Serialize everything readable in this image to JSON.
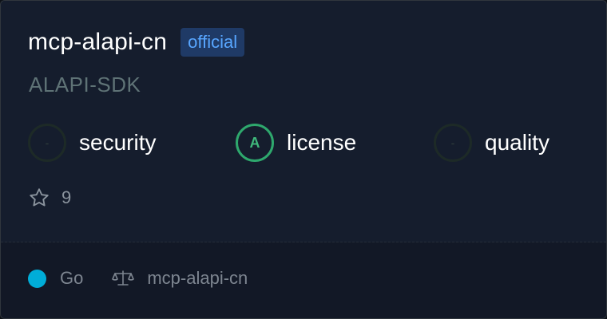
{
  "repo": {
    "name": "mcp-alapi-cn",
    "badge": "official",
    "owner": "ALAPI-SDK"
  },
  "metrics": [
    {
      "label": "security",
      "grade": "-"
    },
    {
      "label": "license",
      "grade": "A"
    },
    {
      "label": "quality",
      "grade": "-"
    }
  ],
  "stars": {
    "count": "9",
    "icon": "star-icon"
  },
  "footer": {
    "language": "Go",
    "language_color": "#00add8",
    "license": "mcp-alapi-cn",
    "license_icon": "scale-icon"
  },
  "colors": {
    "accent": "#58a6ff",
    "grade_a": "#2ea86d"
  }
}
